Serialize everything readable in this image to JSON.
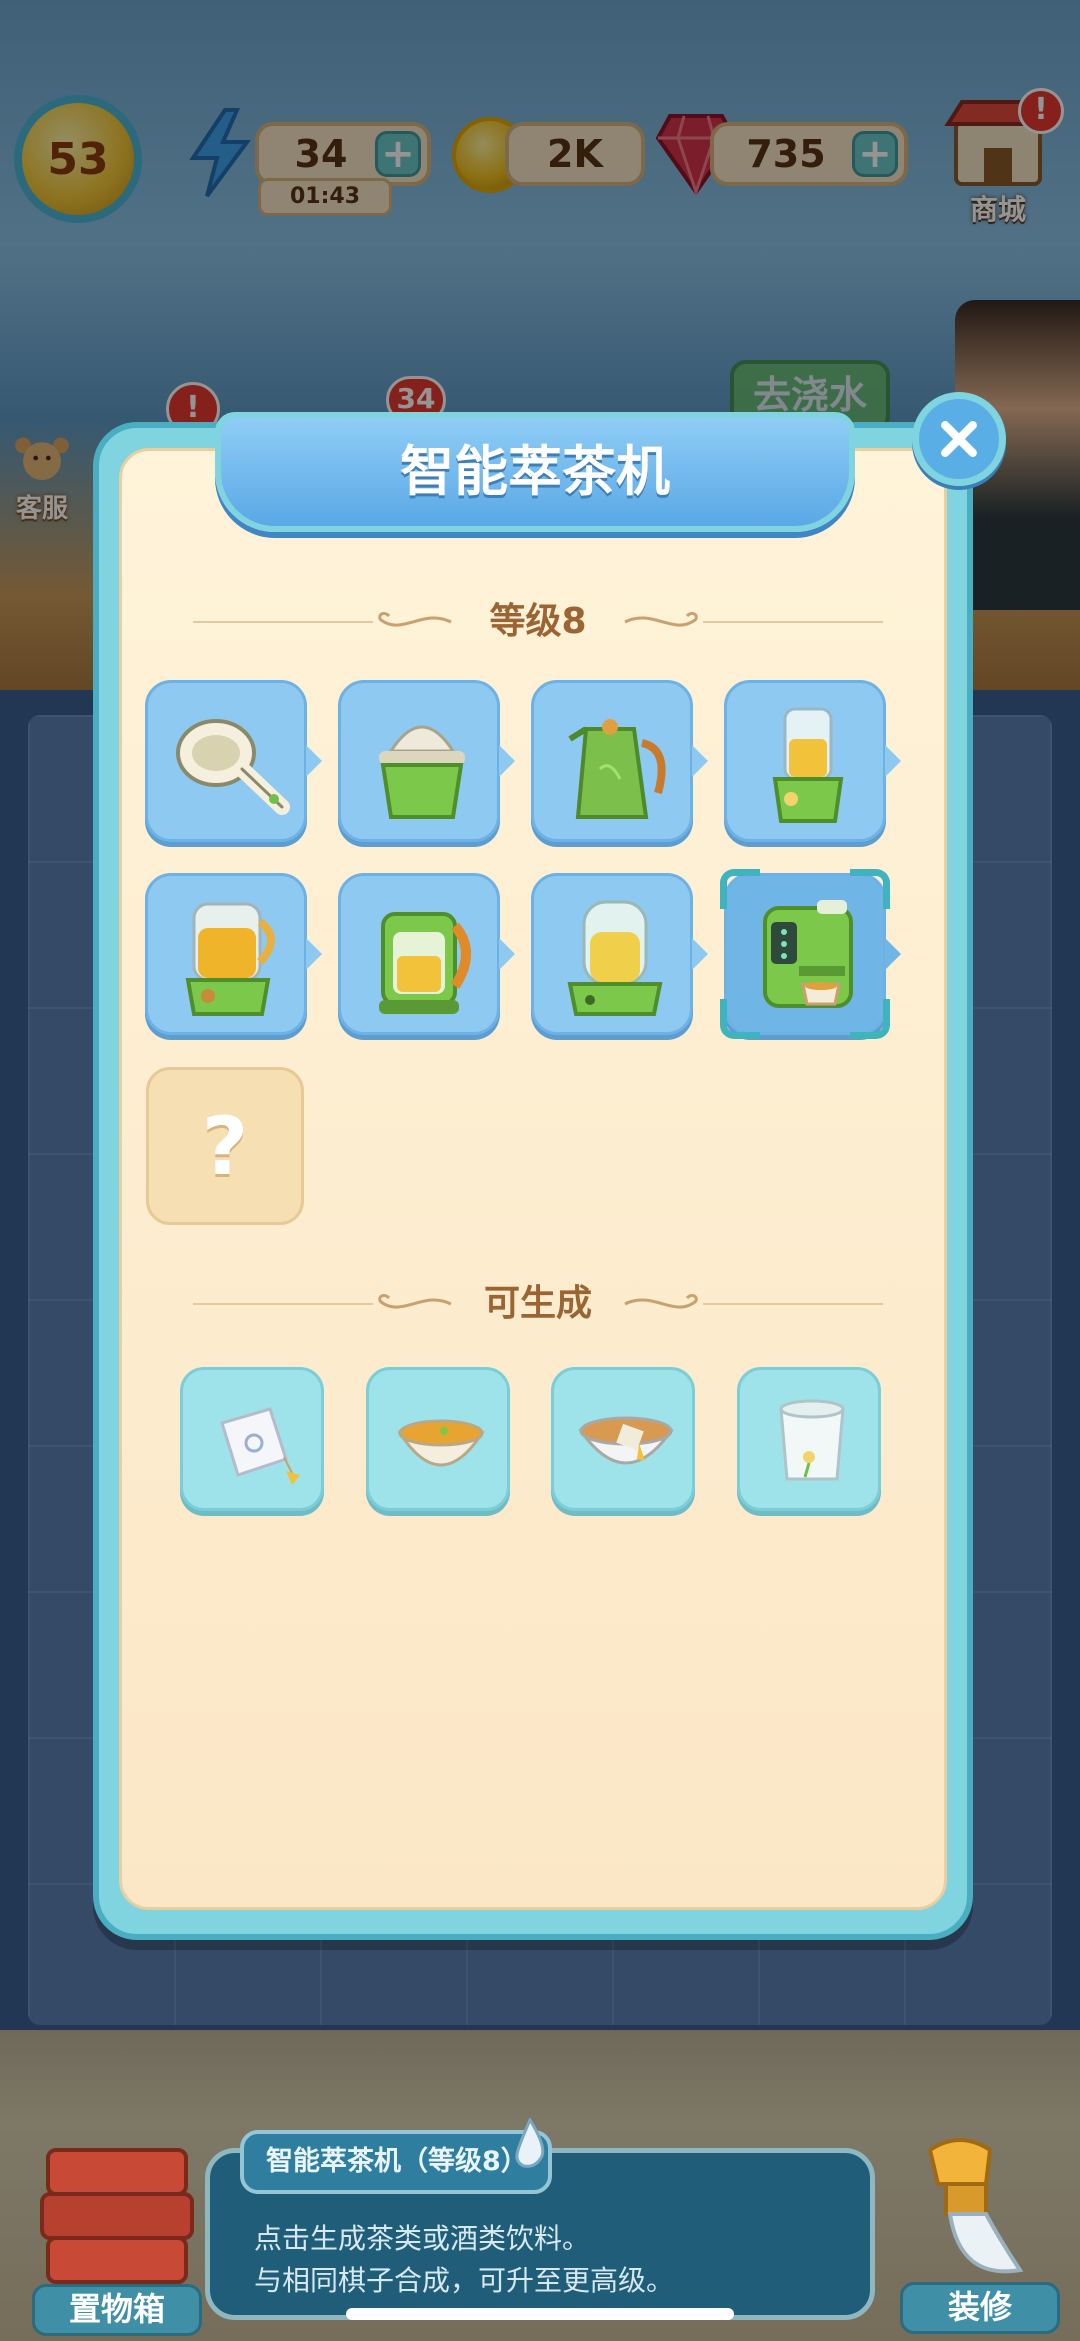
{
  "hud": {
    "level": "53",
    "energy": "34",
    "energy_timer": "01:43",
    "coins": "2K",
    "gems": "735",
    "shop_label": "商城",
    "shop_alert": "!",
    "service_label": "客服",
    "board_alert": "!",
    "board_badge_count": "34",
    "water_label": "去浇水"
  },
  "modal": {
    "title": "智能萃茶机",
    "level_section": "等级8",
    "items": [
      {
        "name": "strainer",
        "icon": "strainer-icon"
      },
      {
        "name": "citrus-press",
        "icon": "citrus-press-icon"
      },
      {
        "name": "tea-kettle",
        "icon": "tea-kettle-icon"
      },
      {
        "name": "small-blender",
        "icon": "small-blender-icon"
      },
      {
        "name": "juicer",
        "icon": "juicer-icon"
      },
      {
        "name": "electric-kettle",
        "icon": "electric-kettle-icon"
      },
      {
        "name": "tea-brewer",
        "icon": "tea-brewer-icon"
      },
      {
        "name": "smart-tea-machine",
        "icon": "coffee-machine-icon",
        "current": true
      }
    ],
    "unknown_item": "?",
    "generate_section": "可生成",
    "products": [
      {
        "name": "tea-bag",
        "icon": "tea-bag-icon"
      },
      {
        "name": "tea-bowl",
        "icon": "tea-bowl-icon"
      },
      {
        "name": "tea-bag-bowl",
        "icon": "tea-bag-bowl-icon"
      },
      {
        "name": "flower-cup",
        "icon": "flower-cup-icon"
      }
    ]
  },
  "bottom": {
    "box_label": "置物箱",
    "info_title": "智能萃茶机（等级8）",
    "info_line1": "点击生成茶类或酒类饮料。",
    "info_line2": "与相同棋子合成，可升至更高级。",
    "decor_label": "装修"
  },
  "colors": {
    "tile_blue": "#8ec9f2",
    "product_tile": "#9ee3ea",
    "modal_frame": "#7fd4e0",
    "modal_bg": "#fff3d9",
    "section_text": "#9b6433",
    "title_banner": "#5aa8e6"
  }
}
